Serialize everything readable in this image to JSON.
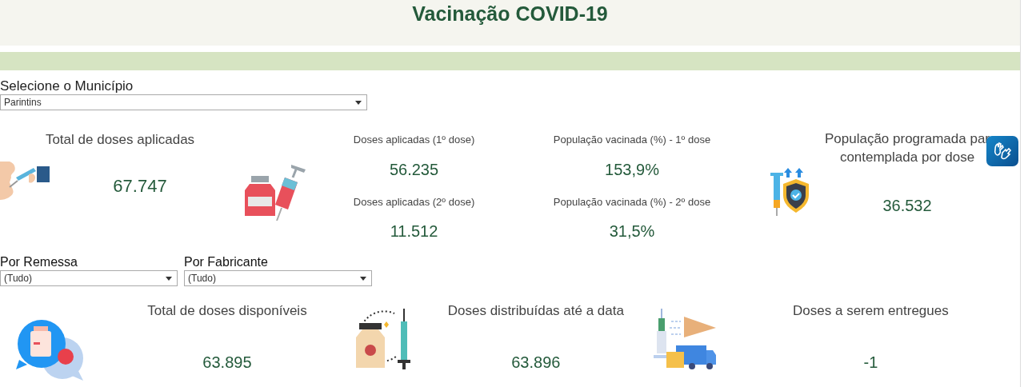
{
  "header": {
    "title": "Vacinação COVID-19"
  },
  "municipality_filter": {
    "label": "Selecione o Município",
    "value": "Parintins"
  },
  "total_applied": {
    "title": "Total de doses aplicadas",
    "value": "67.747"
  },
  "dose_metrics": [
    {
      "label": "Doses aplicadas (1º dose)",
      "value": "56.235"
    },
    {
      "label": "Doses aplicadas (2º dose)",
      "value": "11.512"
    },
    {
      "label": "População vacinada (%) - 1º dose",
      "value": "153,9%"
    },
    {
      "label": "População vacinada (%) - 2º dose",
      "value": "31,5%"
    }
  ],
  "target_population": {
    "title_lines": [
      "População programada par",
      "contemplada por dose"
    ],
    "value": "36.532"
  },
  "filters": [
    {
      "label": "Por Remessa",
      "value": "(Tudo)"
    },
    {
      "label": "Por Fabricante",
      "value": "(Tudo)"
    }
  ],
  "stock_metrics": [
    {
      "title": "Total de doses disponíveis",
      "value": "63.895"
    },
    {
      "title": "Doses distribuídas até a data",
      "value": "63.896"
    },
    {
      "title": "Doses a serem entregues",
      "value": "-1"
    }
  ]
}
